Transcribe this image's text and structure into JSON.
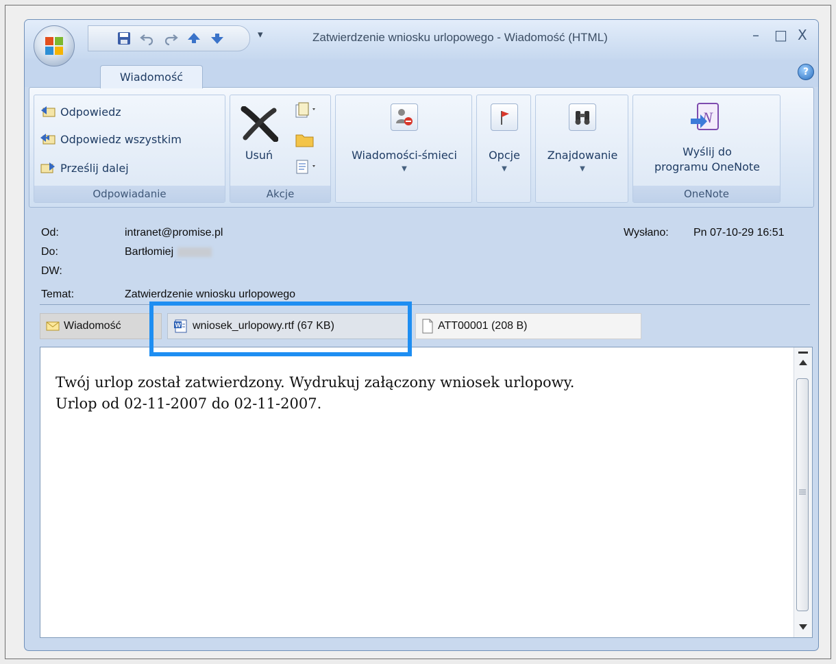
{
  "window": {
    "title": "Zatwierdzenie wniosku urlopowego - Wiadomość (HTML)",
    "minimize_glyph": "–",
    "maximize_glyph": "□",
    "close_glyph": "X"
  },
  "tabs": [
    {
      "label": "Wiadomość"
    }
  ],
  "help_glyph": "?",
  "ribbon": {
    "respond": {
      "label": "Odpowiadanie",
      "reply": "Odpowiedz",
      "reply_all": "Odpowiedz wszystkim",
      "forward": "Prześlij dalej"
    },
    "actions": {
      "label": "Akcje",
      "delete": "Usuń"
    },
    "junk": {
      "label": "Wiadomości-śmieci"
    },
    "options": {
      "label": "Opcje"
    },
    "find": {
      "label": "Znajdowanie"
    },
    "onenote": {
      "label": "OneNote",
      "send_line1": "Wyślij do",
      "send_line2": "programu OneNote"
    }
  },
  "header": {
    "from_label": "Od:",
    "from_value": "intranet@promise.pl",
    "to_label": "Do:",
    "to_value": "Bartłomiej",
    "cc_label": "DW:",
    "subject_label": "Temat:",
    "subject_value": "Zatwierdzenie wniosku urlopowego",
    "sent_label": "Wysłano:",
    "sent_value": "Pn 07-10-29 16:51"
  },
  "attachments": {
    "message_tab": "Wiadomość",
    "items": [
      {
        "name": "wniosek_urlopowy.rtf (67 KB)"
      },
      {
        "name": "ATT00001 (208 B)"
      }
    ]
  },
  "body": {
    "line1": "Twój urlop został zatwierdzony. Wydrukuj załączony wniosek urlopowy.",
    "line2": "Urlop od 02-11-2007 do 02-11-2007."
  },
  "colors": {
    "highlight": "#1e8ef2",
    "accent": "#1e3b63",
    "frame": "#c9d9ee"
  }
}
